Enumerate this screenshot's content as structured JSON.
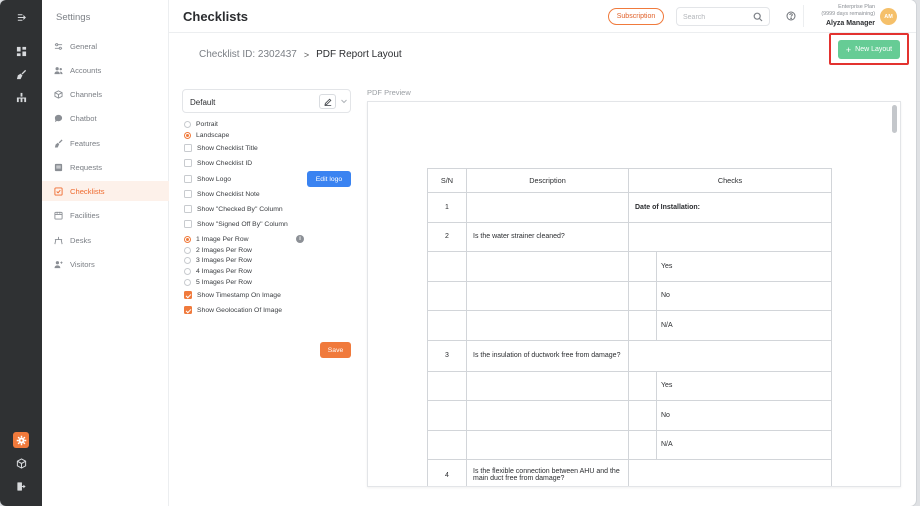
{
  "rail": {
    "icons": [
      "menu-toggle-icon",
      "dashboard-icon",
      "broom-icon",
      "network-icon",
      "settings-icon",
      "cube-icon",
      "logout-icon"
    ]
  },
  "settings_nav": {
    "title": "Settings",
    "items": [
      {
        "label": "General",
        "icon": "sliders-icon",
        "active": false
      },
      {
        "label": "Accounts",
        "icon": "users-icon",
        "active": false
      },
      {
        "label": "Channels",
        "icon": "box-icon",
        "active": false
      },
      {
        "label": "Chatbot",
        "icon": "chat-icon",
        "active": false
      },
      {
        "label": "Features",
        "icon": "broom-icon",
        "active": false
      },
      {
        "label": "Requests",
        "icon": "request-icon",
        "active": false
      },
      {
        "label": "Checklists",
        "icon": "checklist-icon",
        "active": true
      },
      {
        "label": "Facilities",
        "icon": "facility-icon",
        "active": false
      },
      {
        "label": "Desks",
        "icon": "desk-icon",
        "active": false
      },
      {
        "label": "Visitors",
        "icon": "visitor-icon",
        "active": false
      }
    ]
  },
  "header": {
    "title": "Checklists",
    "subscription_label": "Subscription",
    "search_placeholder": "Search",
    "plan_line1": "Enterprise Plan",
    "plan_line2": "(9999 days remaining)",
    "user_name": "Alyza Manager",
    "avatar_initials": "AM"
  },
  "breadcrumb": {
    "parent": "Checklist ID: 2302437",
    "separator": ">",
    "current": "PDF Report Layout"
  },
  "new_layout_label": "New Layout",
  "options": {
    "layout_selected": "Default",
    "orientation": [
      {
        "label": "Portrait",
        "selected": false
      },
      {
        "label": "Landscape",
        "selected": true
      }
    ],
    "toggles": [
      {
        "label": "Show Checklist Title",
        "checked": false
      },
      {
        "label": "Show Checklist ID",
        "checked": false
      },
      {
        "label": "Show Logo",
        "checked": false
      },
      {
        "label": "Show Checklist Note",
        "checked": false
      },
      {
        "label": "Show \"Checked By\" Column",
        "checked": false
      },
      {
        "label": "Show \"Signed Off By\" Column",
        "checked": false
      }
    ],
    "images_per_row": [
      {
        "label": "1 Image Per Row",
        "selected": true
      },
      {
        "label": "2 Images Per Row",
        "selected": false
      },
      {
        "label": "3 Images Per Row",
        "selected": false
      },
      {
        "label": "4 Images Per Row",
        "selected": false
      },
      {
        "label": "5 Images Per Row",
        "selected": false
      }
    ],
    "image_toggles": [
      {
        "label": "Show Timestamp On Image",
        "checked": true
      },
      {
        "label": "Show Geolocation Of Image",
        "checked": true
      }
    ],
    "edit_logo_label": "Edit logo",
    "save_label": "Save"
  },
  "preview": {
    "label": "PDF Preview",
    "columns": [
      "S/N",
      "Description",
      "Checks"
    ],
    "rows": [
      {
        "sn": "1",
        "desc": "",
        "check": "Date of Installation:",
        "kind": "date"
      },
      {
        "sn": "2",
        "desc": "Is the water strainer cleaned?",
        "check": "",
        "kind": "q"
      },
      {
        "sn": "",
        "desc": "",
        "check": "Yes",
        "kind": "opt"
      },
      {
        "sn": "",
        "desc": "",
        "check": "No",
        "kind": "opt"
      },
      {
        "sn": "",
        "desc": "",
        "check": "N/A",
        "kind": "opt"
      },
      {
        "sn": "3",
        "desc": "Is the insulation of ductwork free from damage?",
        "check": "",
        "kind": "q"
      },
      {
        "sn": "",
        "desc": "",
        "check": "Yes",
        "kind": "opt"
      },
      {
        "sn": "",
        "desc": "",
        "check": "No",
        "kind": "opt"
      },
      {
        "sn": "",
        "desc": "",
        "check": "N/A",
        "kind": "opt"
      },
      {
        "sn": "4",
        "desc": "Is the flexible connection between AHU and the main duct free from damage?",
        "check": "",
        "kind": "q"
      },
      {
        "sn": "",
        "desc": "",
        "check": "",
        "kind": "opt"
      }
    ]
  },
  "colors": {
    "accent": "#f07a3c",
    "rail_bg": "#2f3133",
    "new_layout_bg": "#66cc95",
    "edit_logo_bg": "#3a83f1",
    "highlight_border": "#e3322f"
  }
}
